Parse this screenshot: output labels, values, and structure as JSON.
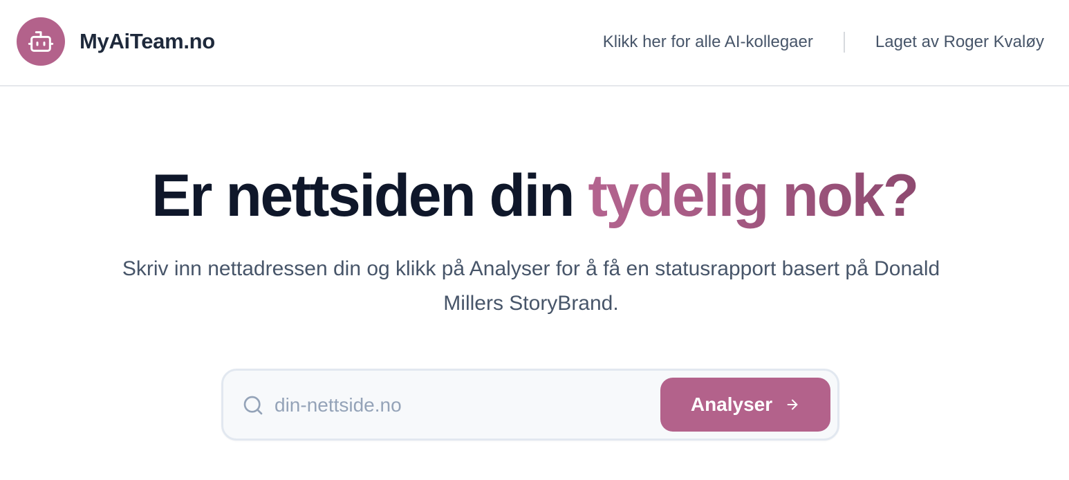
{
  "header": {
    "brand_name": "MyAiTeam.no",
    "logo_icon": "robot-icon",
    "nav": [
      {
        "label": "Klikk her for alle AI-kollegaer"
      },
      {
        "label": "Laget av Roger Kvaløy"
      }
    ]
  },
  "hero": {
    "title_part1": "Er nettsiden din ",
    "title_accent": "tydelig nok?",
    "subtitle": "Skriv inn nettadressen din og klikk på Analyser for å få en statusrapport basert på Donald Millers StoryBrand."
  },
  "search": {
    "placeholder": "din-nettside.no",
    "value": "",
    "search_icon": "search-icon",
    "button_label": "Analyser",
    "button_icon": "arrow-right-icon"
  },
  "colors": {
    "accent": "#b3628b",
    "accent_dark": "#8e4a70",
    "heading": "#0f172a",
    "body_text": "#475569",
    "placeholder": "#94a3b8",
    "input_bg": "#f7f9fb",
    "border": "#e2e8f0"
  }
}
